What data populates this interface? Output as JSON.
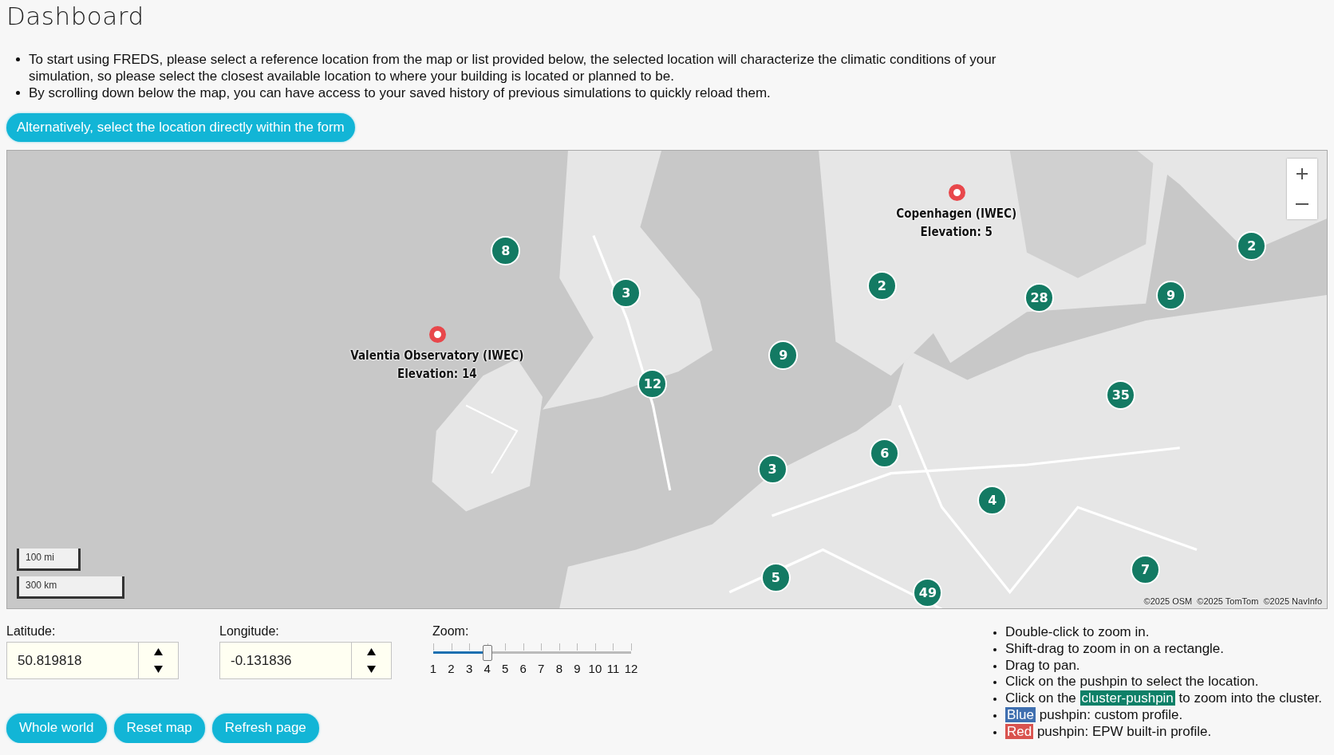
{
  "title": "Dashboard",
  "intro": [
    "To start using FREDS, please select a reference location from the map or list provided below, the selected location will characterize the climatic conditions of your simulation, so please select the closest available location to where your building is located or planned to be.",
    "By scrolling down below the map, you can have access to your saved history of previous simulations to quickly reload them."
  ],
  "form_button": "Alternatively, select the location directly within the form",
  "map": {
    "clusters": [
      {
        "count": "8"
      },
      {
        "count": "3"
      },
      {
        "count": "12"
      },
      {
        "count": "9"
      },
      {
        "count": "2"
      },
      {
        "count": "28"
      },
      {
        "count": "9"
      },
      {
        "count": "2"
      },
      {
        "count": "35"
      },
      {
        "count": "6"
      },
      {
        "count": "3"
      },
      {
        "count": "4"
      },
      {
        "count": "5"
      },
      {
        "count": "7"
      },
      {
        "count": "49"
      }
    ],
    "pins": [
      {
        "name": "Valentia Observatory (IWEC)",
        "elevation": "Elevation: 14",
        "color": "#e8474b"
      },
      {
        "name": "Copenhagen (IWEC)",
        "elevation": "Elevation: 5",
        "color": "#e8474b"
      }
    ],
    "scale": [
      "100 mi",
      "300 km"
    ],
    "attribution": "©2025 OSM  ©2025 TomTom  ©2025 NavInfo"
  },
  "latitude": {
    "label": "Latitude:",
    "value": "50.819818"
  },
  "longitude": {
    "label": "Longitude:",
    "value": "-0.131836"
  },
  "zoom": {
    "label": "Zoom:",
    "ticks": [
      "1",
      "2",
      "3",
      "4",
      "5",
      "6",
      "7",
      "8",
      "9",
      "10",
      "11",
      "12"
    ],
    "level": 0.2727
  },
  "buttons": [
    "Whole world",
    "Reset map",
    "Refresh page"
  ],
  "help": [
    [
      {
        "text": "Double-click to zoom in."
      }
    ],
    [
      {
        "text": "Shift-drag to zoom in on a rectangle."
      }
    ],
    [
      {
        "text": "Drag to pan."
      }
    ],
    [
      {
        "text": "Click on the pushpin to select the location."
      }
    ],
    [
      {
        "text": "Click on the "
      },
      {
        "text": "cluster-pushpin",
        "color": "#0e8067"
      },
      {
        "text": " to zoom into the cluster."
      }
    ],
    [
      {
        "text": "Blue",
        "color": "#3f6fb0"
      },
      {
        "text": " pushpin: custom profile."
      }
    ],
    [
      {
        "text": "Red",
        "color": "#d9534f"
      },
      {
        "text": " pushpin: EPW built-in profile."
      }
    ]
  ]
}
